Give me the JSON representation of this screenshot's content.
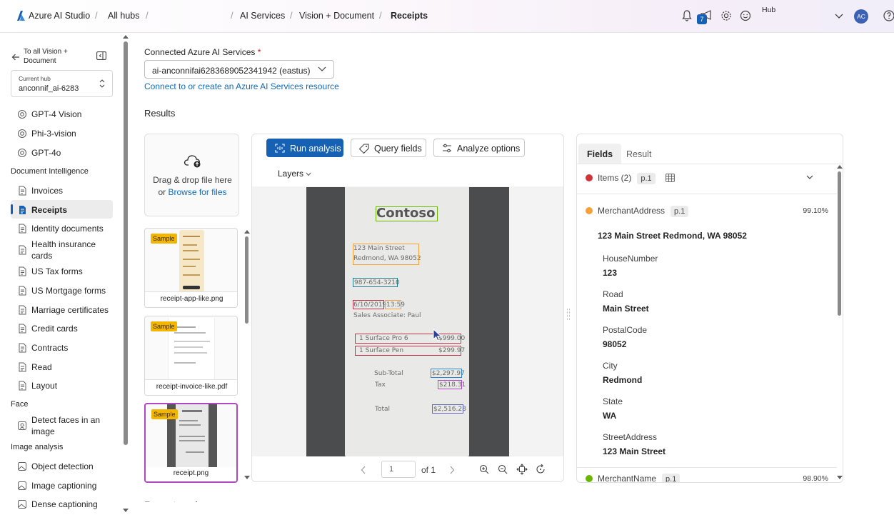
{
  "topbar": {
    "brand": "Azure AI Studio",
    "crumbs": [
      "All hubs",
      "AI Services",
      "Vision + Document",
      "Receipts"
    ],
    "notification_count": "7",
    "hub_label": "Hub",
    "avatar_initials": "AC"
  },
  "sidebar": {
    "back_label_1": "To all Vision +",
    "back_label_2": "Document",
    "hub_caption": "Current hub",
    "hub_name": "anconnif_ai-6283",
    "items_top": [
      "GPT-4 Vision",
      "Phi-3-vision",
      "GPT-4o"
    ],
    "section_doc": "Document Intelligence",
    "items_doc": [
      "Invoices",
      "Receipts",
      "Identity documents",
      "Health insurance cards",
      "US Tax forms",
      "US Mortgage forms",
      "Marriage certificates",
      "Credit cards",
      "Contracts",
      "Read",
      "Layout"
    ],
    "section_face": "Face",
    "items_face": [
      "Detect faces in an image"
    ],
    "section_image": "Image analysis",
    "items_image": [
      "Object detection",
      "Image captioning",
      "Dense captioning"
    ]
  },
  "main": {
    "connected_label": "Connected Azure AI Services",
    "required_mark": "*",
    "connected_value": "ai-anconnifai6283689052341942 (eastus)",
    "connect_link": "Connect to or create an Azure AI Services resource",
    "results_heading": "Results",
    "upload_text": "Drag & drop file here",
    "upload_or": "or",
    "upload_browse": "Browse for files",
    "sample_badge": "Sample",
    "thumbs": [
      "receipt-app-like.png",
      "receipt-invoice-like.pdf",
      "receipt.png"
    ],
    "toolbar": {
      "run": "Run analysis",
      "query": "Query fields",
      "options": "Analyze options",
      "layers": "Layers"
    },
    "pager": {
      "page": "1",
      "of": "of 1"
    },
    "receipt": {
      "store": "Contoso",
      "addr1": "123 Main Street",
      "addr2": "Redmond, WA 98052",
      "phone": "987-654-3210",
      "date": "6/10/2019",
      "time": "13:59",
      "associate": "Sales Associate: Paul",
      "item1": "1 Surface Pro 6",
      "price1": "$999.00",
      "item2": "1 Surface Pen",
      "price2": "$299.97",
      "subtotal_label": "Sub-Total",
      "subtotal": "$2,297.97",
      "tax_label": "Tax",
      "tax": "$218.31",
      "total_label": "Total",
      "total": "$2,516.28"
    },
    "bottom_partial": "Recent analyses"
  },
  "panel": {
    "tabs": [
      "Fields",
      "Result"
    ],
    "items_label": "Items (2)",
    "page_tag": "p.1",
    "merchant_address_label": "MerchantAddress",
    "merchant_address_conf": "99.10%",
    "merchant_address_value": "123 Main Street Redmond, WA 98052",
    "subfields": [
      {
        "name": "HouseNumber",
        "value": "123"
      },
      {
        "name": "Road",
        "value": "Main Street"
      },
      {
        "name": "PostalCode",
        "value": "98052"
      },
      {
        "name": "City",
        "value": "Redmond"
      },
      {
        "name": "State",
        "value": "WA"
      },
      {
        "name": "StreetAddress",
        "value": "123 Main Street"
      }
    ],
    "merchant_name_label": "MerchantName",
    "merchant_name_conf": "98.90%",
    "colors": {
      "items": "#d13438",
      "address": "#f7a13a",
      "name": "#6bb700"
    }
  },
  "colors": {
    "accent": "#1661b3",
    "link": "#0f6cbd",
    "sample": "#f2b600",
    "selected_thumb": "#b146c2"
  }
}
